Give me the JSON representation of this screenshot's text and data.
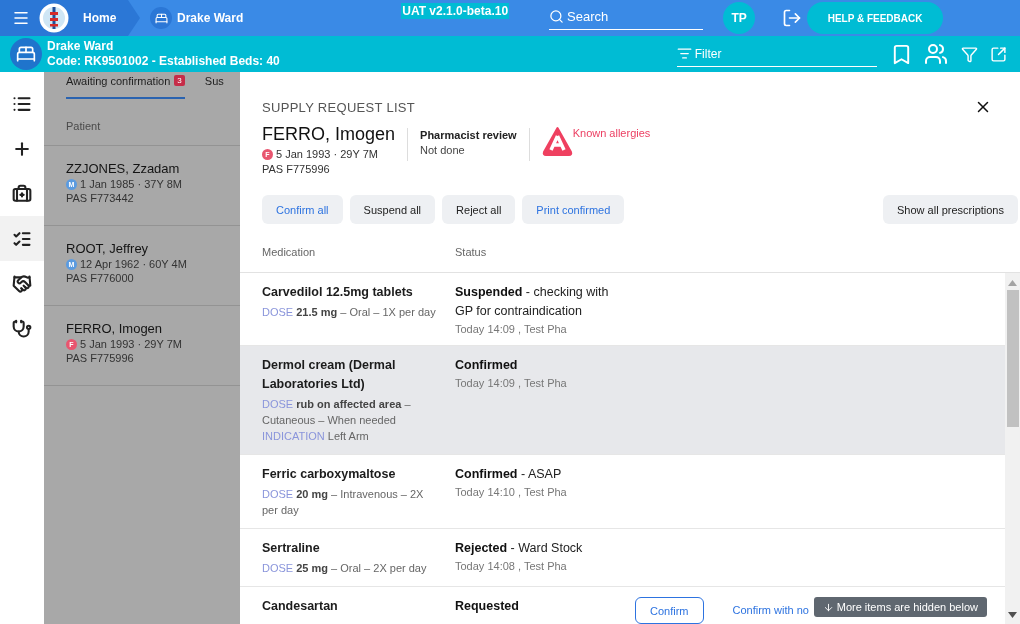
{
  "topbar": {
    "breadcrumbs": [
      {
        "label": "Home"
      },
      {
        "label": "Drake Ward"
      }
    ],
    "environment": "UAT v2.1.0-beta.10",
    "search": {
      "placeholder": "Search"
    },
    "user_initials": "TP",
    "help_button": "HELP & FEEDBACK"
  },
  "ward_bar": {
    "name": "Drake Ward",
    "details": "Code: RK9501002 - Established Beds: 40",
    "filter": {
      "placeholder": "Filter"
    }
  },
  "rail": {
    "items": [
      {
        "selected": false
      },
      {
        "selected": false
      },
      {
        "selected": false
      },
      {
        "selected": true
      },
      {
        "selected": false
      },
      {
        "selected": false
      }
    ]
  },
  "patient_list": {
    "tabs": [
      {
        "label": "Awaiting confirmation",
        "badge": "3",
        "selected": true
      },
      {
        "label": "Sus",
        "selected": false
      }
    ],
    "columns": [
      "Patient"
    ],
    "rows": [
      {
        "name": "ZZJONES, Zzadam",
        "sex": "M",
        "color": "#5b9be0",
        "dob_age": "1 Jan 1985 · 37Y 8M",
        "pas": "PAS F773442"
      },
      {
        "name": "ROOT, Jeffrey",
        "sex": "M",
        "color": "#5b9be0",
        "dob_age": "12 Apr 1962 · 60Y 4M",
        "pas": "PAS F776000"
      },
      {
        "name": "FERRO, Imogen",
        "sex": "F",
        "color": "#e8556f",
        "dob_age": "5 Jan 1993 · 29Y 7M",
        "pas": "PAS F775996"
      }
    ]
  },
  "drawer": {
    "title": "SUPPLY REQUEST LIST",
    "patient": {
      "name": "FERRO, Imogen",
      "sex": "F",
      "color": "#e8556f",
      "dob_age": "5 Jan 1993 · 29Y 7M",
      "pas": "PAS F775996"
    },
    "review": {
      "label": "Pharmacist review",
      "value": "Not done"
    },
    "allergy": {
      "label": "Known allergies"
    },
    "actions": [
      {
        "label": "Confirm all",
        "kind": "primary"
      },
      {
        "label": "Suspend all",
        "kind": "default"
      },
      {
        "label": "Reject all",
        "kind": "default"
      },
      {
        "label": "Print confirmed",
        "kind": "primary"
      }
    ],
    "show_all": "Show all prescriptions",
    "columns": [
      "Medication",
      "Status"
    ],
    "rows": [
      {
        "medication": "Carvedilol 12.5mg tablets",
        "dose": {
          "label": "DOSE",
          "value": "**21.5 mg** – Oral – 1X per day"
        },
        "status": "**Suspended** - checking with GP for contraindication",
        "timestamp": "Today 14:09 , Test Pha",
        "selected": false
      },
      {
        "medication": "Dermol cream (Dermal Laboratories Ltd)",
        "dose": {
          "label": "DOSE",
          "value": "**rub on affected area** – Cutaneous – When needed"
        },
        "indication": {
          "label": "INDICATION",
          "value": "Left Arm"
        },
        "status": "**Confirmed**",
        "timestamp": "Today 14:09 , Test Pha",
        "selected": true
      },
      {
        "medication": "Ferric carboxymaltose",
        "dose": {
          "label": "DOSE",
          "value": "**20 mg** – Intravenous – 2X per day"
        },
        "status": "**Confirmed** - ASAP",
        "timestamp": "Today 14:10 , Test Pha",
        "selected": false
      },
      {
        "medication": "Sertraline",
        "dose": {
          "label": "DOSE",
          "value": "**25 mg** – Oral – 2X per day"
        },
        "status": "**Rejected** - Ward Stock",
        "timestamp": "Today 14:08 , Test Pha",
        "selected": false
      },
      {
        "medication": "Candesartan",
        "status": "**Requested**",
        "selected": false,
        "actions": [
          {
            "label": "Confirm",
            "kind": "outlined"
          },
          {
            "label": "Confirm with no",
            "kind": "link"
          }
        ]
      }
    ],
    "toast": "More items are hidden below"
  }
}
